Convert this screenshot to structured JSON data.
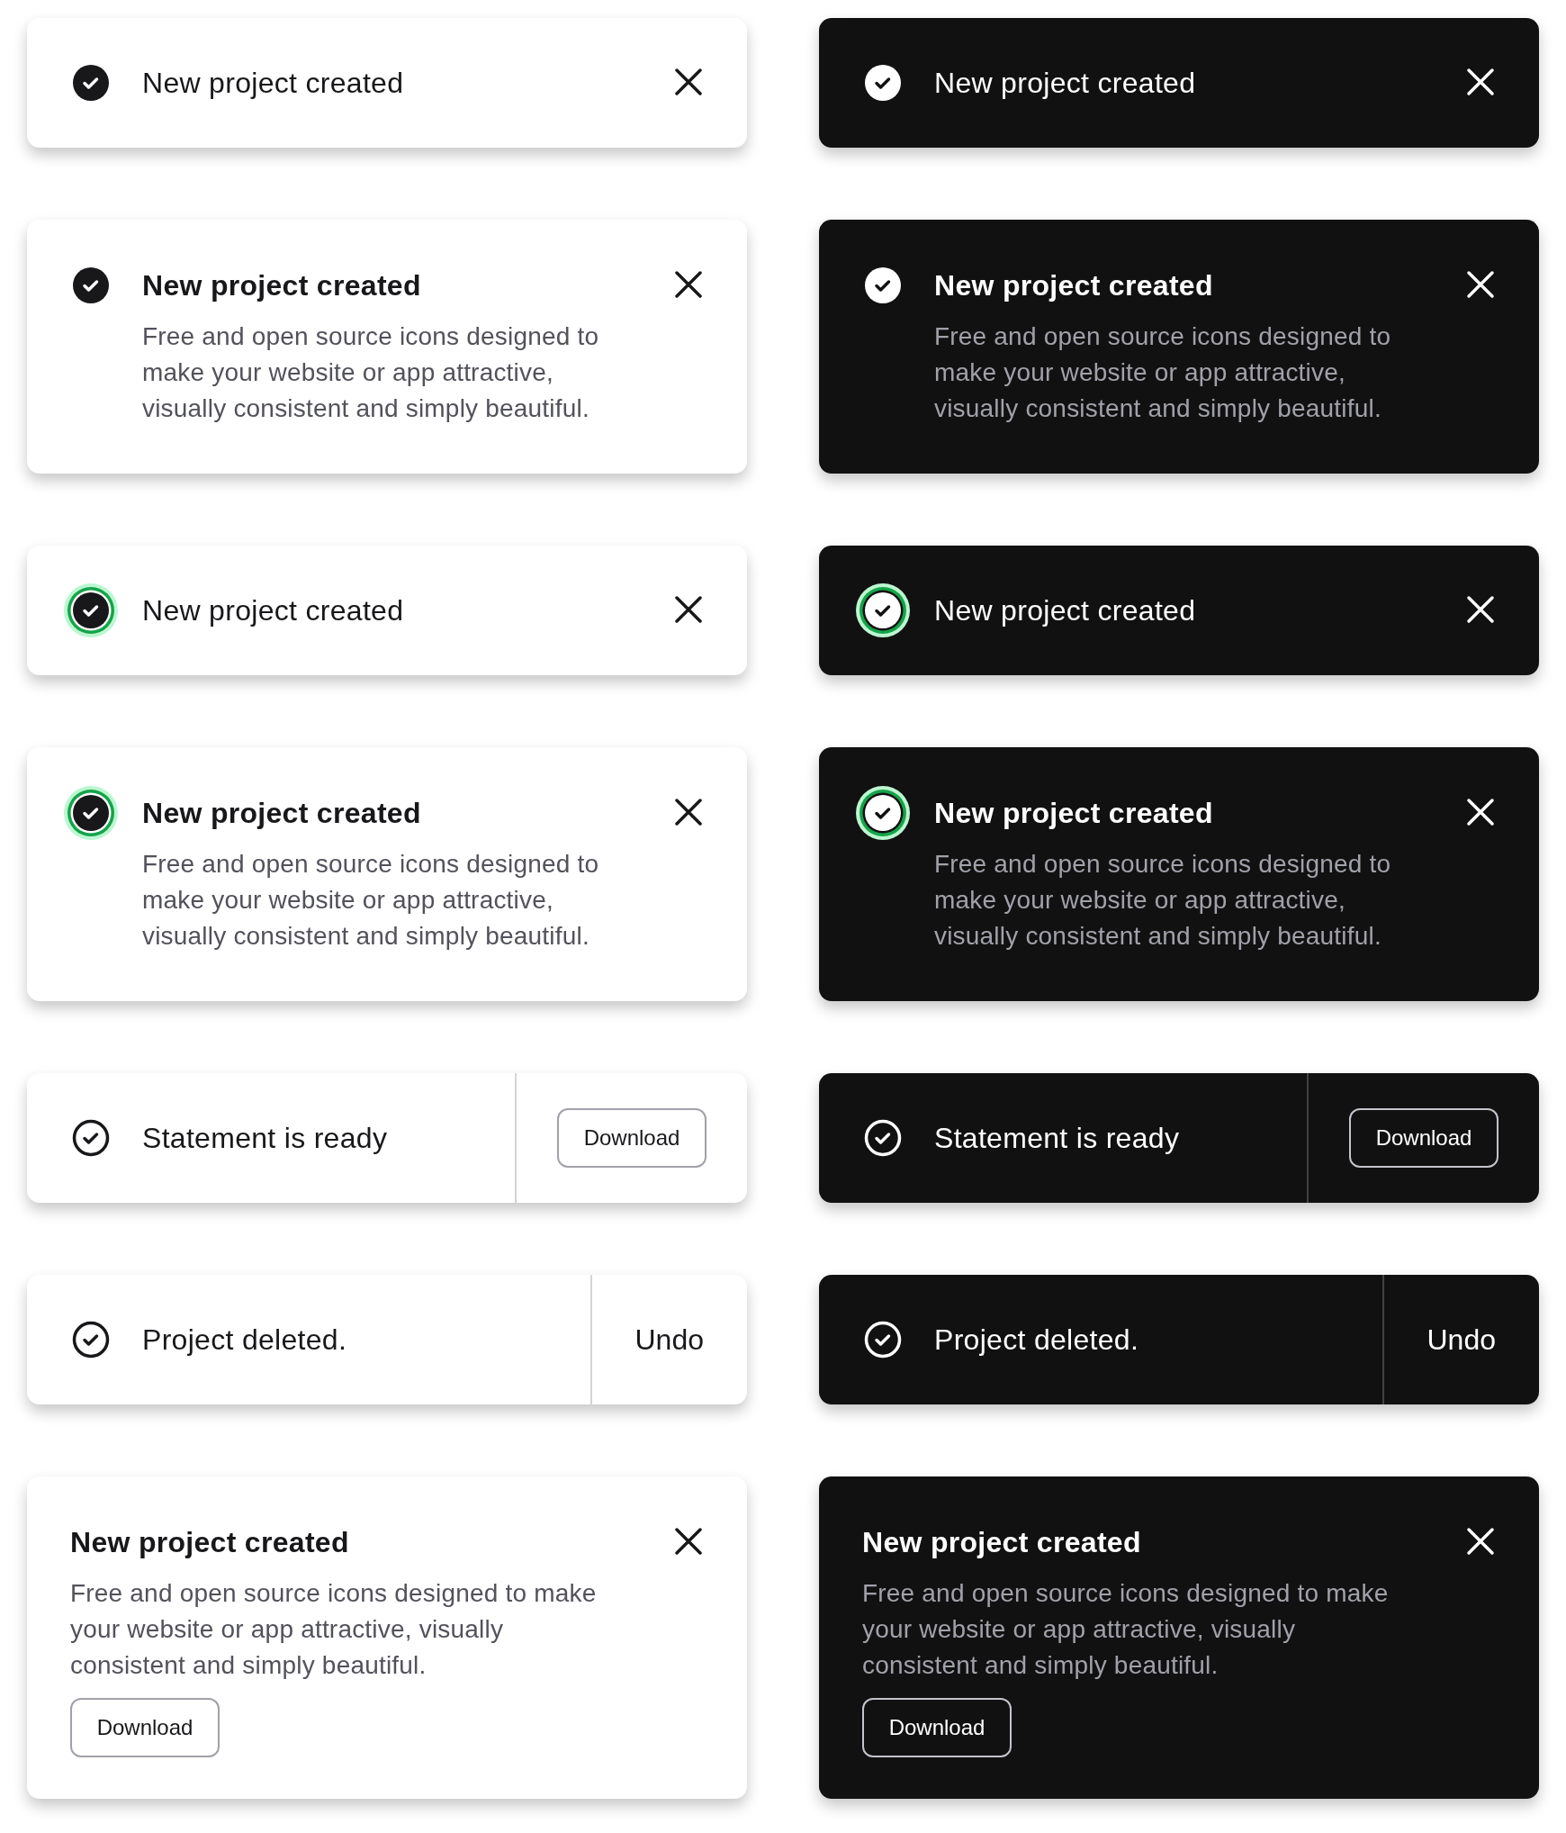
{
  "columns": [
    {
      "toasts": [
        {
          "kind": "basic",
          "title": "New project created"
        },
        {
          "kind": "basic",
          "title": "New project created",
          "description_lines": [
            "Free and open source icons designed to",
            "make your website or app attractive,",
            "visually consistent and simply beautiful."
          ]
        },
        {
          "kind": "highlight",
          "title": "New project created"
        },
        {
          "kind": "highlight",
          "title": "New project created",
          "description_lines": [
            "Free and open source icons designed to",
            "make your website or app attractive,",
            "visually consistent and simply beautiful."
          ]
        },
        {
          "kind": "button",
          "title": "Statement is ready",
          "action": "Download"
        },
        {
          "kind": "undo",
          "title": "Project deleted.",
          "action": "Undo"
        },
        {
          "kind": "card",
          "title": "New project created",
          "description_lines": [
            "Free and open source icons designed to make",
            "your website or app attractive, visually",
            "consistent and simply beautiful."
          ],
          "action": "Download"
        }
      ]
    },
    {
      "toasts": [
        {
          "kind": "basic",
          "title": "New project created"
        },
        {
          "kind": "basic",
          "title": "New project created",
          "description_lines": [
            "Free and open source icons designed to",
            "make your website or app attractive,",
            "visually consistent and simply beautiful."
          ]
        },
        {
          "kind": "highlight",
          "title": "New project created"
        },
        {
          "kind": "highlight",
          "title": "New project created",
          "description_lines": [
            "Free and open source icons designed to",
            "make your website or app attractive,",
            "visually consistent and simply beautiful."
          ]
        },
        {
          "kind": "button",
          "title": "Statement is ready",
          "action": "Download"
        },
        {
          "kind": "undo",
          "title": "Project deleted.",
          "action": "Undo"
        },
        {
          "kind": "card",
          "title": "New project created",
          "description_lines": [
            "Free and open source icons designed to make",
            "your website or app attractive, visually",
            "consistent and simply beautiful."
          ],
          "action": "Download"
        }
      ]
    }
  ]
}
